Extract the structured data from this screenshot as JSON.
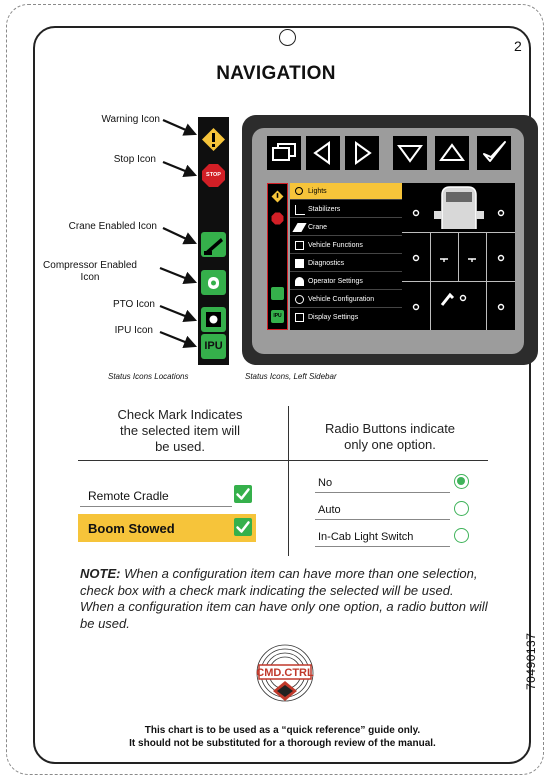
{
  "page": {
    "number": "2",
    "title": "NAVIGATION",
    "part_number": "70490137"
  },
  "status_labels": {
    "warning": "Warning Icon",
    "stop": "Stop Icon",
    "crane": "Crane Enabled Icon",
    "compressor": "Compressor Enabled Icon",
    "pto": "PTO Icon",
    "ipu": "IPU Icon"
  },
  "sidebar_icons": {
    "stop_text": "STOP",
    "ipu_text": "IPU"
  },
  "display": {
    "menu_items": [
      "Lights",
      "Stabilizers",
      "Crane",
      "Vehicle Functions",
      "Diagnostics",
      "Operator Settings",
      "Vehicle Configuration",
      "Display Settings"
    ],
    "active_item": "Lights",
    "toolbar_icons": [
      "windows-icon",
      "left-arrow-icon",
      "right-arrow-icon",
      "down-arrow-icon",
      "up-arrow-icon",
      "checkmark-icon"
    ]
  },
  "captions": {
    "left": "Status Icons Locations",
    "right": "Status Icons, Left Sidebar"
  },
  "check_section": {
    "header_line1": "Check Mark Indicates",
    "header_line2": "the selected item will",
    "header_line3": "be used.",
    "items": [
      {
        "label": "Remote Cradle",
        "checked": true,
        "highlight": false
      },
      {
        "label": "Boom Stowed",
        "checked": true,
        "highlight": true
      }
    ]
  },
  "radio_section": {
    "header_line1": "Radio Buttons indicate",
    "header_line2": "only one option.",
    "options": [
      {
        "label": "No",
        "selected": true
      },
      {
        "label": "Auto",
        "selected": false
      },
      {
        "label": "In-Cab Light Switch",
        "selected": false
      }
    ]
  },
  "note": {
    "prefix": "NOTE:",
    "text": " When a configuration item can have more than one selection, check box with a check mark indicating the selected will be used. When a configuration item can have only one option, a radio button will be used."
  },
  "logo": {
    "brand": "CMD.CTRL"
  },
  "footer": {
    "line1": "This chart is to be used as a “quick reference” guide only.",
    "line2": "It should not be substituted for a thorough review of the manual."
  },
  "colors": {
    "accent_yellow": "#f6c43a",
    "check_green": "#35b04b",
    "stop_red": "#d21f26",
    "device_dark": "#2c2c2c"
  }
}
